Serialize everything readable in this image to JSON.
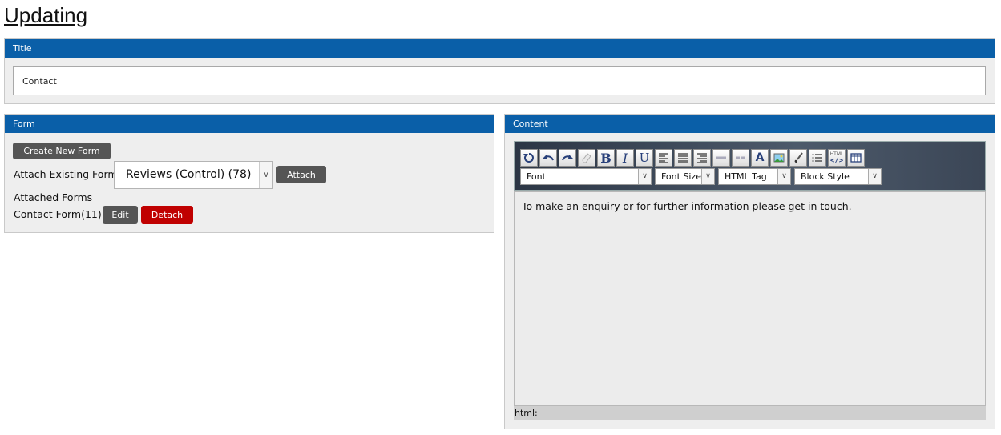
{
  "page": {
    "title": "Updating"
  },
  "title_panel": {
    "header": "Title",
    "value": "Contact"
  },
  "form_panel": {
    "header": "Form",
    "create_label": "Create New Form",
    "attach_existing_label": "Attach Existing Form",
    "selected_form": "Reviews (Control) (78)",
    "attach_label": "Attach",
    "attached_forms_label": "Attached Forms",
    "attached_form_name": "Contact Form(11)",
    "edit_label": "Edit",
    "detach_label": "Detach"
  },
  "content_panel": {
    "header": "Content",
    "dropdowns": {
      "font": "Font",
      "font_size": "Font Size",
      "html_tag": "HTML Tag",
      "block_style": "Block Style"
    },
    "body_text": "To make an enquiry or for further information please get in touch.",
    "status_label": "html:",
    "html_button_label": "HTML"
  },
  "icons": [
    "undo-icon",
    "redo-icon",
    "eraser-icon",
    "bold-icon",
    "italic-icon",
    "underline-icon",
    "align-left-icon",
    "align-center-icon",
    "align-right-icon",
    "link-icon",
    "unlink-icon",
    "font-color-icon",
    "image-icon",
    "brush-icon",
    "list-icon",
    "html-source-icon",
    "table-icon"
  ],
  "colors": {
    "header_blue": "#0a5fa8",
    "detach_red": "#c00000",
    "button_gray": "#555555"
  }
}
